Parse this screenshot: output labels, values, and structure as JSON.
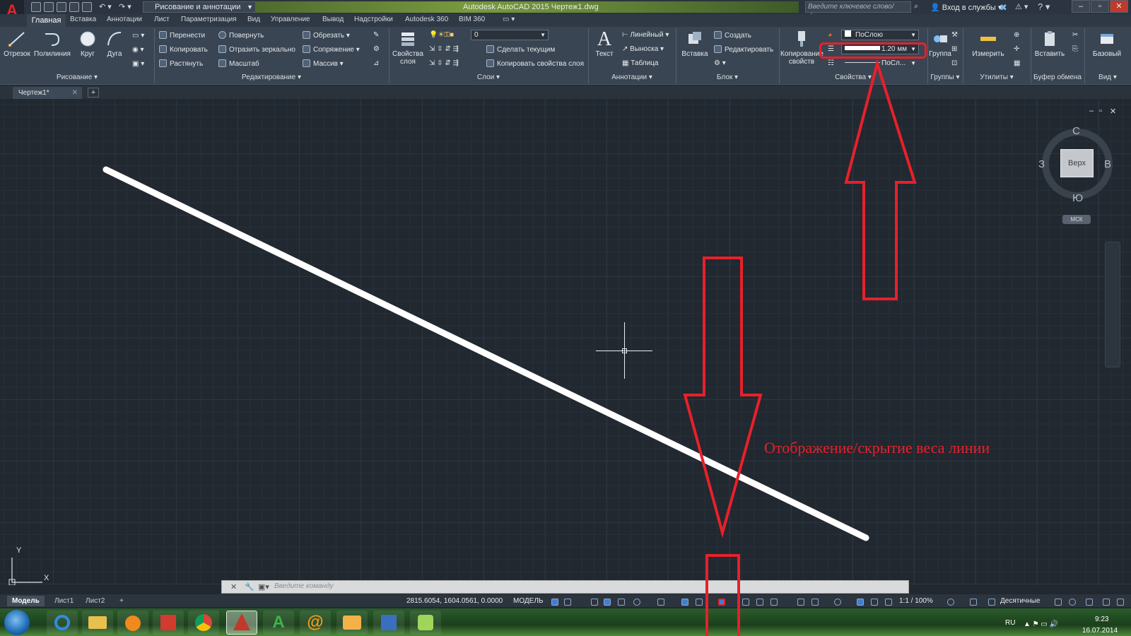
{
  "app": {
    "title": "Autodesk AutoCAD 2015   Чертеж1.dwg",
    "workspace": "Рисование и аннотации",
    "search_placeholder": "Введите ключевое слово/фразу",
    "signin": "Вход в службы",
    "logo": "A"
  },
  "ribbon_tabs": [
    "Главная",
    "Вставка",
    "Аннотации",
    "Лист",
    "Параметризация",
    "Вид",
    "Управление",
    "Вывод",
    "Надстройки",
    "Autodesk 360",
    "BIM 360"
  ],
  "panels": {
    "draw": {
      "title": "Рисование",
      "tools": [
        "Отрезок",
        "Полилиния",
        "Круг",
        "Дуга"
      ]
    },
    "modify": {
      "title": "Редактирование",
      "items": [
        "Перенести",
        "Повернуть",
        "Обрезать",
        "Копировать",
        "Отразить зеркально",
        "Сопряжение",
        "Растянуть",
        "Масштаб",
        "Массив"
      ]
    },
    "layers": {
      "title": "Слои",
      "big": "Свойства слоя",
      "current_layer": "0",
      "items": [
        "Сделать текущим",
        "Копировать свойства слоя"
      ]
    },
    "annotations": {
      "title": "Аннотации",
      "big": "Текст",
      "items": [
        "Линейный",
        "Выноска",
        "Таблица"
      ]
    },
    "block": {
      "title": "Блок",
      "big": "Вставка",
      "items": [
        "Создать",
        "Редактировать"
      ]
    },
    "properties": {
      "title": "Свойства",
      "big": "Копирование свойств",
      "color": "ПоСлою",
      "lineweight": "1.20 мм",
      "linetype": "ПоСл..."
    },
    "groups": {
      "title": "Группы",
      "big": "Группа"
    },
    "utilities": {
      "title": "Утилиты",
      "big": "Измерить"
    },
    "clipboard": {
      "title": "Буфер обмена",
      "big": "Вставить"
    },
    "view": {
      "title": "Вид",
      "big": "Базовый"
    }
  },
  "document_tab": "Чертеж1*",
  "viewcube": {
    "top": "Верх",
    "north": "С",
    "south": "Ю",
    "west": "З",
    "east": "В",
    "wcs": "МСК"
  },
  "ucs": {
    "x": "X",
    "y": "Y"
  },
  "command_line": {
    "placeholder": "Введите команду"
  },
  "layout_tabs": [
    "Модель",
    "Лист1",
    "Лист2"
  ],
  "status": {
    "coords": "2815.6054, 1604.0561, 0.0000",
    "model": "МОДЕЛЬ",
    "scale": "1:1 / 100%",
    "units": "Десятичные"
  },
  "tray": {
    "lang": "RU",
    "time": "9:23",
    "date": "16.07.2014"
  },
  "annotation": {
    "label": "Отображение/скрытие веса линии",
    "color": "#e8202a"
  },
  "colors": {
    "canvas": "#212830",
    "ribbon": "#3a4553",
    "line": "#ffffff",
    "accent_red": "#e8202a"
  }
}
